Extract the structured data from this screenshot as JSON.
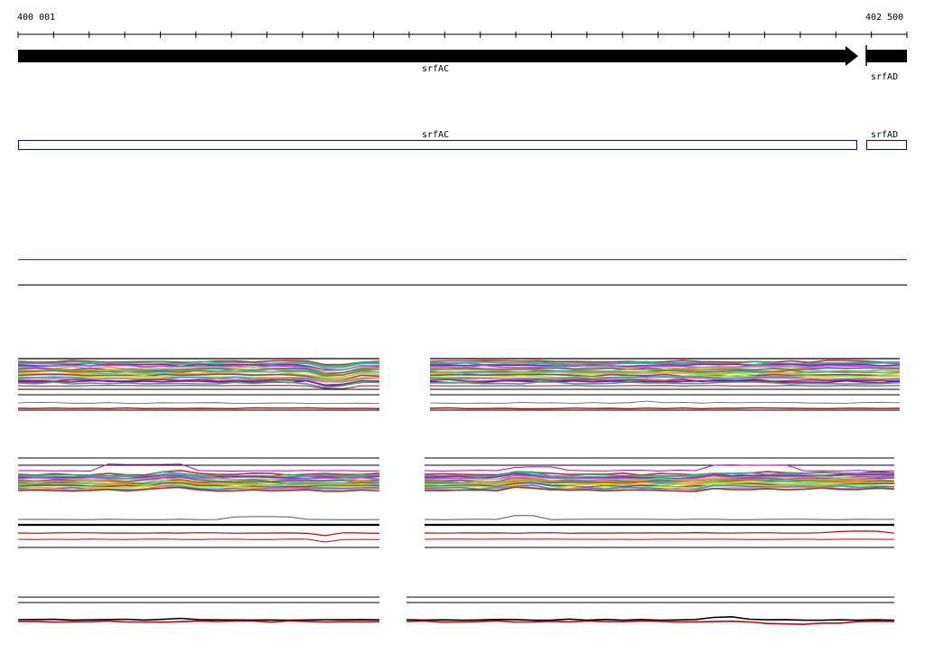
{
  "ruler": {
    "start_label": "400 001",
    "end_label": "402 500"
  },
  "genes": [
    {
      "name": "srfAC",
      "strand": "+"
    },
    {
      "name": "srfAD",
      "strand": "+"
    }
  ],
  "annotation_boxes": [
    {
      "name": "srfAC"
    },
    {
      "name": "srfAD"
    }
  ],
  "colors": {
    "gene_fill": "#000000",
    "annotation_box": "#0000cc",
    "reference_line": "#cc0000",
    "palette": [
      "#e6194b",
      "#3cb44b",
      "#00bfbf",
      "#911eb4",
      "#f032e6",
      "#9acd32",
      "#4363d8",
      "#f58231",
      "#808000",
      "#00e0e0",
      "#ffb000",
      "#b03060",
      "#7cfc00",
      "#1e90ff",
      "#ff69b4",
      "#8b4513",
      "#9400d3",
      "#20b2aa"
    ]
  }
}
